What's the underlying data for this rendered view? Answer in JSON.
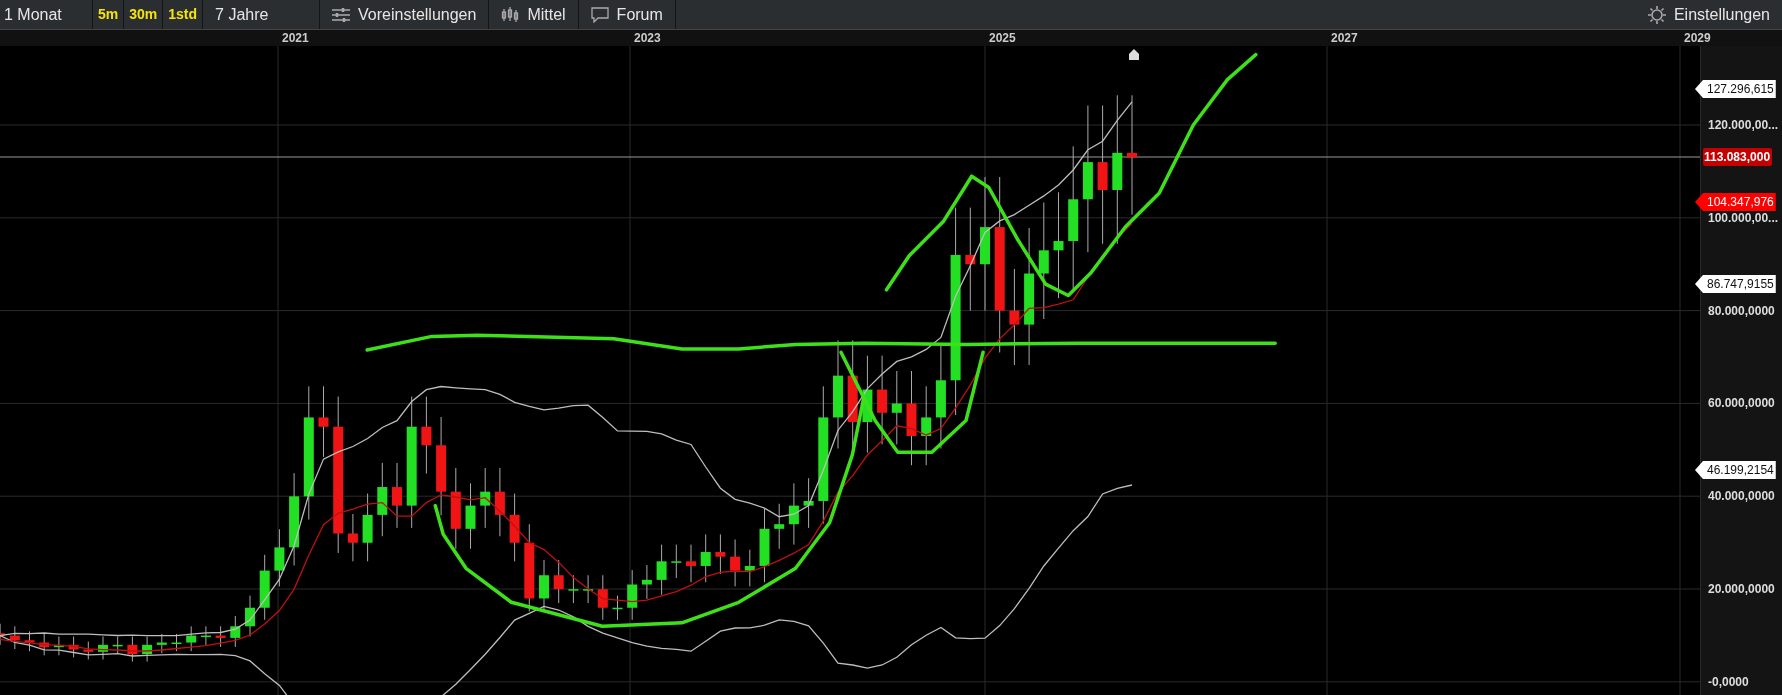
{
  "toolbar": {
    "interval": "1 Monat",
    "quick_intervals": [
      {
        "label": "5m"
      },
      {
        "label": "30m"
      },
      {
        "label": "1std"
      }
    ],
    "range": "7 Jahre",
    "buttons": [
      {
        "kind": "presets",
        "label": "Voreinstellungen"
      },
      {
        "kind": "candles",
        "label": "Mittel"
      },
      {
        "kind": "forum",
        "label": "Forum"
      }
    ],
    "settings": "Einstellungen"
  },
  "time_axis": [
    "2021",
    "2023",
    "2025",
    "2027",
    "2029"
  ],
  "price_axis": [
    "120.000,00...",
    "100.000,00...",
    "80.000,0000",
    "60.000,0000",
    "40.000,0000",
    "20.000,0000",
    "-0,0000"
  ],
  "price_tags": [
    {
      "kind": "arrow",
      "label": "127.296,615",
      "color": "#ffffff"
    },
    {
      "kind": "box",
      "label": "113.083,000",
      "color": "#c40000"
    },
    {
      "kind": "arrow",
      "label": "104.347,976",
      "color": "#ff0000"
    },
    {
      "kind": "arrow",
      "label": "86.747,9155",
      "color": "#ffffff"
    },
    {
      "kind": "arrow",
      "label": "46.199,2154",
      "color": "#ffffff"
    }
  ]
}
